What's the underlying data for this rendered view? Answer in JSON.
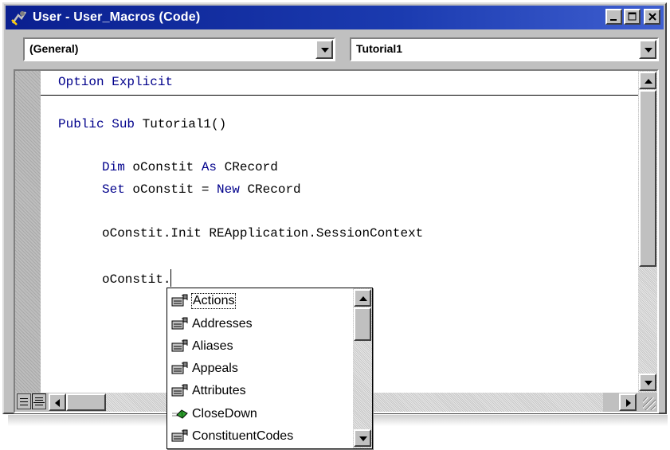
{
  "window": {
    "title": "User - User_Macros (Code)",
    "buttons": [
      "minimize",
      "maximize",
      "close"
    ],
    "colors": {
      "titlebar": "#0a1f8f",
      "keyword": "#00008b"
    }
  },
  "object_combo": {
    "value": "(General)"
  },
  "procedure_combo": {
    "value": "Tutorial1"
  },
  "code": {
    "option_line": {
      "kw": "Option Explicit"
    },
    "sub_line": {
      "kw": "Public Sub",
      "rest": " Tutorial1()"
    },
    "dim_line": {
      "kw1": "Dim",
      "mid": " oConstit ",
      "kw2": "As",
      "rest": " CRecord"
    },
    "set_line": {
      "kw1": "Set",
      "mid": " oConstit = ",
      "kw2": "New",
      "rest": " CRecord"
    },
    "init_line": {
      "text": "oConstit.Init REApplication.SessionContext"
    },
    "member_line": {
      "text": "oConstit."
    }
  },
  "autocomplete": {
    "items": [
      {
        "label": "Actions",
        "icon": "property-icon",
        "selected": true
      },
      {
        "label": "Addresses",
        "icon": "property-icon"
      },
      {
        "label": "Aliases",
        "icon": "property-icon"
      },
      {
        "label": "Appeals",
        "icon": "property-icon"
      },
      {
        "label": "Attributes",
        "icon": "property-icon"
      },
      {
        "label": "CloseDown",
        "icon": "method-icon"
      },
      {
        "label": "ConstituentCodes",
        "icon": "property-icon"
      }
    ]
  }
}
